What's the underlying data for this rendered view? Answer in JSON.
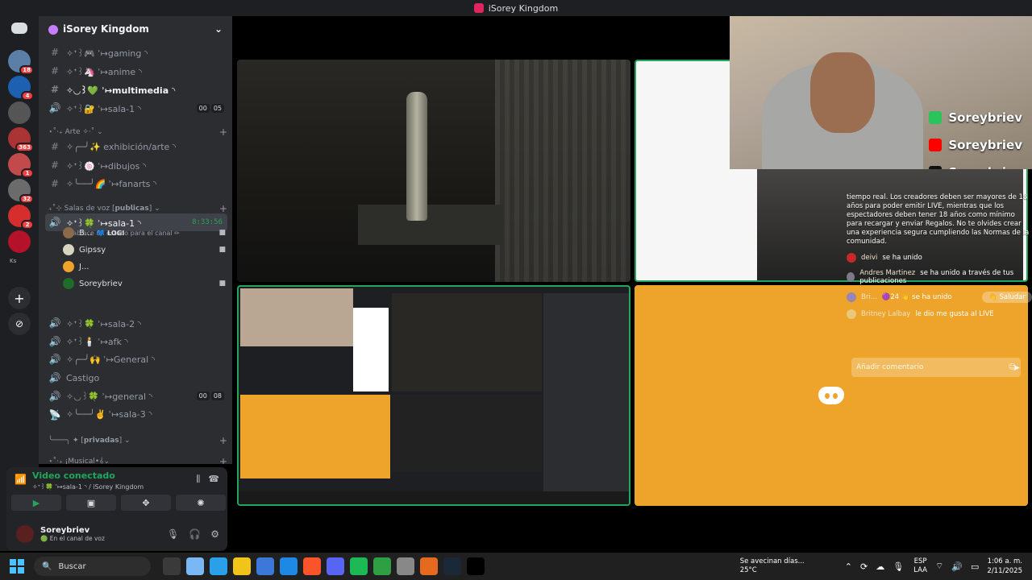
{
  "window": {
    "title": "iSorey Kingdom"
  },
  "server_rail": {
    "items": [
      {
        "badge": "18",
        "color": "#5b7fa6"
      },
      {
        "badge": "4",
        "color": "#1d5fb0"
      },
      {
        "badge": "",
        "color": "#555555"
      },
      {
        "badge": "363",
        "color": "#aa3333"
      },
      {
        "badge": "1",
        "color": "#c24a4a"
      },
      {
        "badge": "32",
        "color": "#6b6b6b"
      },
      {
        "badge": "2",
        "color": "#d62d2d"
      },
      {
        "badge": "",
        "color": "#b3122a"
      }
    ],
    "label_ks": "Ks"
  },
  "guild": {
    "name": "iSorey Kingdom",
    "channels": [
      {
        "icon": "#",
        "label": "✧ᕀ꒱🎮 ʾ↦gaming ◝",
        "bold": false
      },
      {
        "icon": "#",
        "label": "✧ᕀ꒱🦄 ʾ↦anime ◝",
        "bold": false
      },
      {
        "icon": "#",
        "label": "✧◡꒱💚 ʾ↦multimedia ◝",
        "bold": true
      },
      {
        "icon": "🔊",
        "label": "✧ᕀ꒱🔐 ʾ↦sala-1 ◝",
        "bold": false,
        "c1": "00",
        "c2": "05"
      }
    ],
    "cat_arte": "⋆˚‧₊ Arte ✧·˚ ⌄",
    "arte_channels": [
      {
        "icon": "#",
        "label": "✧╭─╯✨ exhibición/arte ◝"
      },
      {
        "icon": "#",
        "label": "✧ᕀ꒱🍥 ʾ↦dibujos ◝"
      },
      {
        "icon": "#",
        "label": "✧╰──╯🌈 ʾ↦fanarts ◝"
      }
    ],
    "cat_salas": "₊˚⊹ Salas de voz [𝗽𝘂𝗯𝗹𝗶𝗰𝗮𝘀] ⌄",
    "active_voice": {
      "label": "✧ᕀ꒱🍀 ʾ↦sala-1 ◝",
      "timer": "8:33:56",
      "status": "Establece un estado para el canal ✏"
    },
    "voice_users": [
      {
        "name": "B...",
        "tag": "💙 LOGI",
        "color": "#8a6a4a"
      },
      {
        "name": "Gipssy",
        "tag": "",
        "color": "#d6d6c0"
      },
      {
        "name": "J...",
        "tag": "",
        "color": "#eea42b"
      },
      {
        "name": "Soreybriev",
        "tag": "",
        "color": "#1f6b2a"
      }
    ],
    "more_voice": [
      {
        "icon": "🔊",
        "label": "✧ᕀ꒱🍀 ʾ↦sala-2 ◝"
      },
      {
        "icon": "🔊",
        "label": "✧ᕀ꒱🕯️ ʾ↦afk ◝"
      },
      {
        "icon": "🔊",
        "label": "✧╭─╯🙌 ʾ↦General ◝"
      },
      {
        "icon": "🔊",
        "label": "Castigo"
      },
      {
        "icon": "🔊",
        "label": "✧◡꒱🍀 ʾ↦general ◝",
        "c1": "00",
        "c2": "08"
      },
      {
        "icon": "📡",
        "label": "✧╰──╯✌️ ʾ↦sala-3 ◝"
      }
    ],
    "cat_privadas": "╰───╮ ✦ [𝗽𝗿𝗶𝘃𝗮𝗱𝗮𝘀] ⌄",
    "cat_musical": "⋆˚‧₊ ¡Musical•𝄞⌄"
  },
  "voice_panel": {
    "title": "Video conectado",
    "subtitle": "✧ᕀ꒱🍀 ʾ↦sala-1 ◝ / iSorey Kingdom"
  },
  "user": {
    "name": "Soreybriev",
    "status": "🟢 En el canal de voz"
  },
  "overlay": {
    "socials": [
      {
        "name": "Soreybriev",
        "color": "#2cc35c"
      },
      {
        "name": "Soreybriev",
        "color": "#ff0000"
      },
      {
        "name": "Soreybriev",
        "color": "#111111"
      }
    ]
  },
  "chat": {
    "notice": "tiempo real. Los creadores deben ser mayores de 18 años para poder emitir LIVE, mientras que los espectadores deben tener 18 años como mínimo para recargar y enviar Regalos. No te olvides crear una experiencia segura cumpliendo las Normas de la comunidad.",
    "messages": [
      {
        "name": "deivi",
        "text": "se ha unido"
      },
      {
        "name": "Andres Martinez",
        "text": "se ha unido a través de tus publicaciones"
      },
      {
        "name": "Bri...",
        "text": "🟣24 👋 se ha unido",
        "action": "👋 Saludar"
      },
      {
        "name": "Britney Lalbay",
        "text": "le dio me gusta al LIVE"
      }
    ],
    "placeholder": "Añadir comentario"
  },
  "taskbar": {
    "search": "Buscar",
    "weather_line1": "Se avecinan días...",
    "weather_line2": "25°C",
    "lang1": "ESP",
    "lang2": "LAA",
    "time": "1:06 a. m.",
    "date": "2/11/2025",
    "apps": [
      "#3a3a3a",
      "#7ab8f5",
      "#2aa0e8",
      "#f0c419",
      "#3b78d8",
      "#1e88e5",
      "#fb542b",
      "#5865f2",
      "#1db954",
      "#2ea043",
      "#888888",
      "#e56a1f",
      "#1b2838",
      "#000000"
    ]
  }
}
